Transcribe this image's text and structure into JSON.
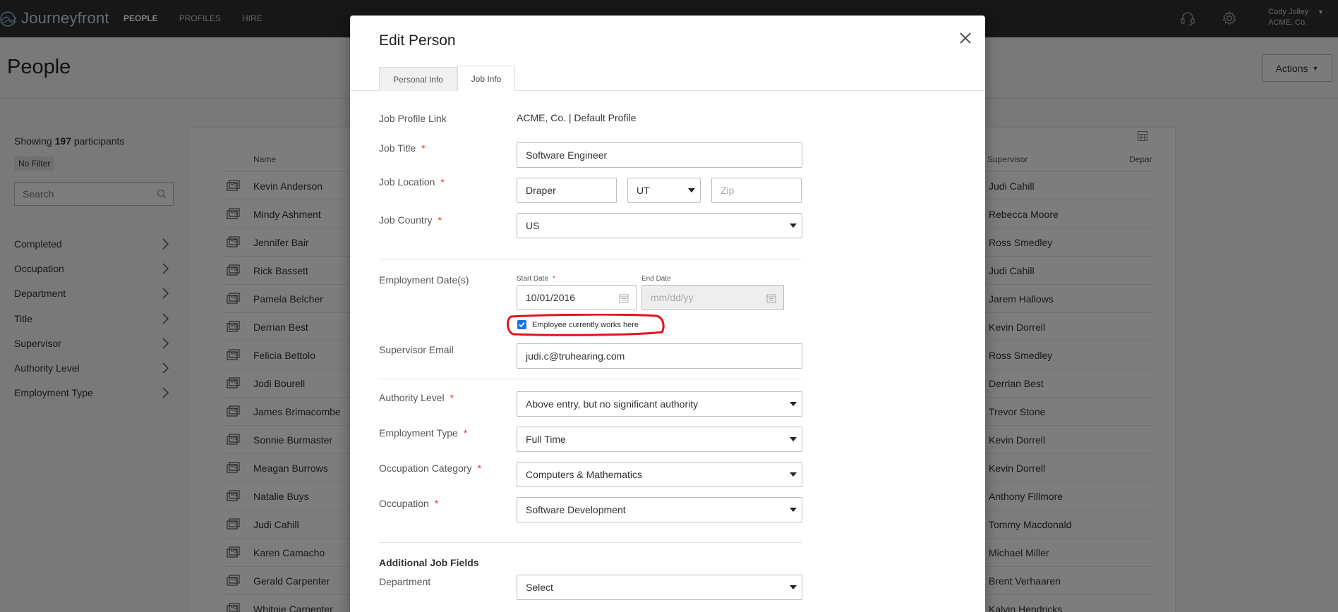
{
  "app": {
    "brand": "Journeyfront",
    "nav": [
      {
        "label": "PEOPLE",
        "active": true
      },
      {
        "label": "PROFILES",
        "active": false
      },
      {
        "label": "HIRE",
        "active": false
      }
    ],
    "user_name": "Cody Jolley",
    "user_company": "ACME, Co."
  },
  "page": {
    "title": "People",
    "actions_label": "Actions"
  },
  "sidebar": {
    "showing_prefix": "Showing",
    "showing_count": "197",
    "showing_suffix": "participants",
    "filter_badge": "No Filter",
    "search_placeholder": "Search",
    "filters": [
      "Completed",
      "Occupation",
      "Department",
      "Title",
      "Supervisor",
      "Authority Level",
      "Employment Type"
    ]
  },
  "table": {
    "col_name": "Name",
    "col_supervisor": "Supervisor",
    "col_department": "Depar",
    "rows": [
      {
        "name": "Kevin Anderson",
        "supervisor": "Judi Cahill"
      },
      {
        "name": "Mindy Ashment",
        "supervisor": "Rebecca Moore"
      },
      {
        "name": "Jennifer Bair",
        "supervisor": "Ross Smedley"
      },
      {
        "name": "Rick Bassett",
        "supervisor": "Judi Cahill"
      },
      {
        "name": "Pamela Belcher",
        "supervisor": "Jarem Hallows"
      },
      {
        "name": "Derrian Best",
        "supervisor": "Kevin Dorrell"
      },
      {
        "name": "Felicia Bettolo",
        "supervisor": "Ross Smedley"
      },
      {
        "name": "Jodi Bourell",
        "supervisor": "Derrian Best"
      },
      {
        "name": "James Brimacombe",
        "supervisor": "Trevor Stone"
      },
      {
        "name": "Sonnie Burmaster",
        "supervisor": "Kevin Dorrell"
      },
      {
        "name": "Meagan Burrows",
        "supervisor": "Kevin Dorrell"
      },
      {
        "name": "Natalie Buys",
        "supervisor": "Anthony Fillmore"
      },
      {
        "name": "Judi Cahill",
        "supervisor": "Tommy Macdonald"
      },
      {
        "name": "Karen Camacho",
        "supervisor": "Michael Miller"
      },
      {
        "name": "Gerald Carpenter",
        "supervisor": "Brent Verhaaren"
      },
      {
        "name": "Whitnie Carpenter",
        "supervisor": "Kalvin Hendricks"
      }
    ]
  },
  "modal": {
    "title": "Edit Person",
    "tabs": [
      "Personal Info",
      "Job Info"
    ],
    "labels": {
      "job_profile_link": "Job Profile Link",
      "job_title": "Job Title",
      "job_location": "Job Location",
      "job_country": "Job Country",
      "employment_dates": "Employment Date(s)",
      "start_date": "Start Date",
      "end_date": "End Date",
      "supervisor_email": "Supervisor Email",
      "authority_level": "Authority Level",
      "employment_type": "Employment Type",
      "occupation_category": "Occupation Category",
      "occupation": "Occupation",
      "additional_fields": "Additional Job Fields",
      "department": "Department",
      "currently_works": "Employee currently works here"
    },
    "values": {
      "job_profile_link": "ACME, Co. | Default Profile",
      "job_title": "Software Engineer",
      "city": "Draper",
      "state": "UT",
      "zip_placeholder": "Zip",
      "country": "US",
      "start_date": "10/01/2016",
      "end_date_placeholder": "mm/dd/yy",
      "currently_works_checked": true,
      "supervisor_email": "judi.c@truhearing.com",
      "authority_level": "Above entry, but no significant authority",
      "employment_type": "Full Time",
      "occupation_category": "Computers & Mathematics",
      "occupation": "Software Development",
      "department": "Select"
    },
    "required_mark": "*"
  },
  "colors": {
    "topbar": "#2e2e2e",
    "required": "#dd3333",
    "checkbox": "#1a73e8",
    "annotation": "#e0141e"
  }
}
